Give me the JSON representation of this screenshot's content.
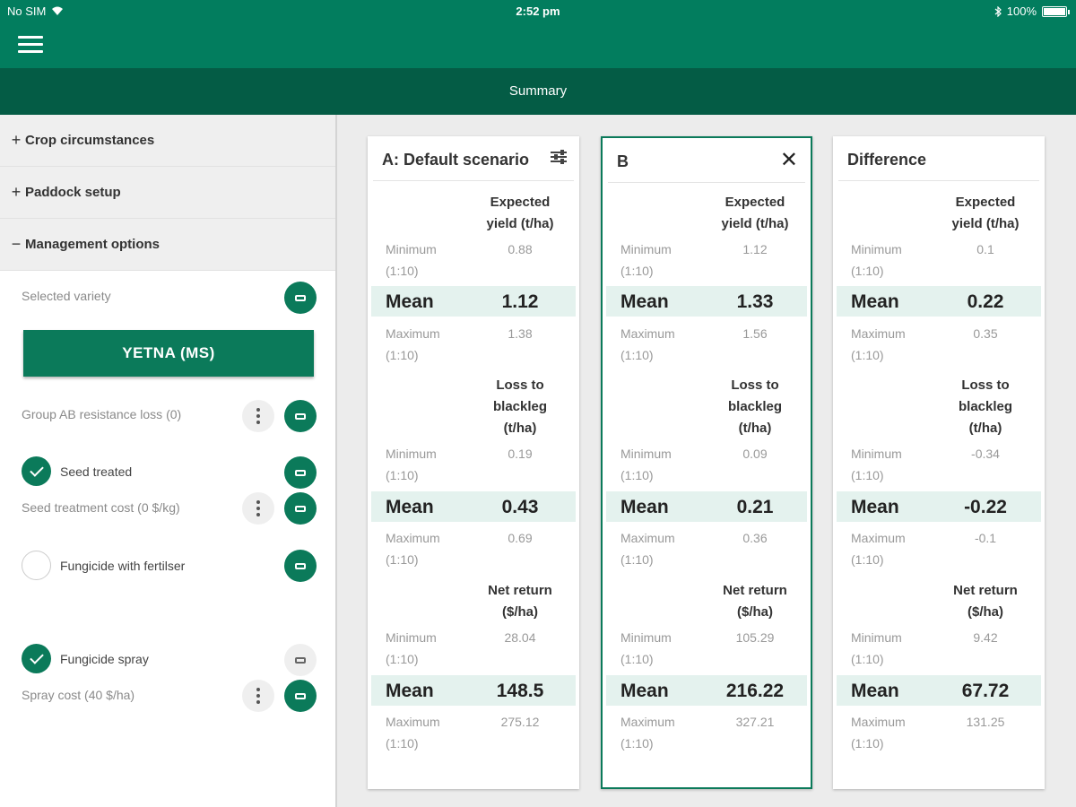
{
  "status_bar": {
    "carrier": "No SIM",
    "time": "2:52 pm",
    "battery": "100%",
    "battery_level": 1.0
  },
  "header": {
    "title": "Summary"
  },
  "sidebar": {
    "sections": [
      {
        "sign": "+",
        "label": "Crop circumstances"
      },
      {
        "sign": "+",
        "label": "Paddock setup"
      },
      {
        "sign": "−",
        "label": "Management options"
      }
    ],
    "options": {
      "selected_variety_label": "Selected variety",
      "variety_button": "YETNA (MS)",
      "group_ab_label": "Group AB resistance loss (0)",
      "seed_treated_label": "Seed treated",
      "seed_treated_checked": true,
      "seed_cost_label": "Seed treatment cost (0 $/kg)",
      "fungicide_fert_label": "Fungicide with fertilser",
      "fungicide_fert_checked": false,
      "fungicide_spray_label": "Fungicide spray",
      "fungicide_spray_checked": true,
      "spray_cost_label": "Spray cost (40 $/ha)"
    }
  },
  "cards": [
    {
      "title": "A: Default scenario",
      "yield": {
        "heading": [
          "Expected",
          "yield (t/ha)"
        ],
        "min_label": [
          "Minimum",
          "(1:10)"
        ],
        "min": "0.88",
        "mean_label": "Mean",
        "mean": "1.12",
        "max_label": [
          "Maximum",
          "(1:10)"
        ],
        "max": "1.38"
      },
      "loss": {
        "heading": [
          "Loss to",
          "blackleg",
          "(t/ha)"
        ],
        "min_label": [
          "Minimum",
          "(1:10)"
        ],
        "min": "0.19",
        "mean_label": "Mean",
        "mean": "0.43",
        "max_label": [
          "Maximum",
          "(1:10)"
        ],
        "max": "0.69"
      },
      "net": {
        "heading": [
          "Net return",
          "($/ha)"
        ],
        "min_label": [
          "Minimum",
          "(1:10)"
        ],
        "min": "28.04",
        "mean_label": "Mean",
        "mean": "148.5",
        "max_label": [
          "Maximum",
          "(1:10)"
        ],
        "max": "275.12"
      }
    },
    {
      "title": "B",
      "yield": {
        "heading": [
          "Expected",
          "yield (t/ha)"
        ],
        "min_label": [
          "Minimum",
          "(1:10)"
        ],
        "min": "1.12",
        "mean_label": "Mean",
        "mean": "1.33",
        "max_label": [
          "Maximum",
          "(1:10)"
        ],
        "max": "1.56"
      },
      "loss": {
        "heading": [
          "Loss to",
          "blackleg",
          "(t/ha)"
        ],
        "min_label": [
          "Minimum",
          "(1:10)"
        ],
        "min": "0.09",
        "mean_label": "Mean",
        "mean": "0.21",
        "max_label": [
          "Maximum",
          "(1:10)"
        ],
        "max": "0.36"
      },
      "net": {
        "heading": [
          "Net return",
          "($/ha)"
        ],
        "min_label": [
          "Minimum",
          "(1:10)"
        ],
        "min": "105.29",
        "mean_label": "Mean",
        "mean": "216.22",
        "max_label": [
          "Maximum",
          "(1:10)"
        ],
        "max": "327.21"
      }
    },
    {
      "title": "Difference",
      "yield": {
        "heading": [
          "Expected",
          "yield (t/ha)"
        ],
        "min_label": [
          "Minimum",
          "(1:10)"
        ],
        "min": "0.1",
        "mean_label": "Mean",
        "mean": "0.22",
        "max_label": [
          "Maximum",
          "(1:10)"
        ],
        "max": "0.35"
      },
      "loss": {
        "heading": [
          "Loss to",
          "blackleg",
          "(t/ha)"
        ],
        "min_label": [
          "Minimum",
          "(1:10)"
        ],
        "min": "-0.34",
        "mean_label": "Mean",
        "mean": "-0.22",
        "max_label": [
          "Maximum",
          "(1:10)"
        ],
        "max": "-0.1"
      },
      "net": {
        "heading": [
          "Net return",
          "($/ha)"
        ],
        "min_label": [
          "Minimum",
          "(1:10)"
        ],
        "min": "9.42",
        "mean_label": "Mean",
        "mean": "67.72",
        "max_label": [
          "Maximum",
          "(1:10)"
        ],
        "max": "131.25"
      }
    }
  ],
  "colors": {
    "brand_green": "#027d5e",
    "dark_green": "#045c45",
    "button_green": "#0b7a5a",
    "mean_row_bg": "#e4f2ee"
  },
  "icons": {
    "menu": "hamburger-icon",
    "wifi": "wifi-icon",
    "bluetooth": "bluetooth-icon",
    "tune": "tune-icon",
    "close": "close-icon",
    "edit": "edit-icon",
    "more": "more-vert-icon",
    "check": "check-icon"
  }
}
